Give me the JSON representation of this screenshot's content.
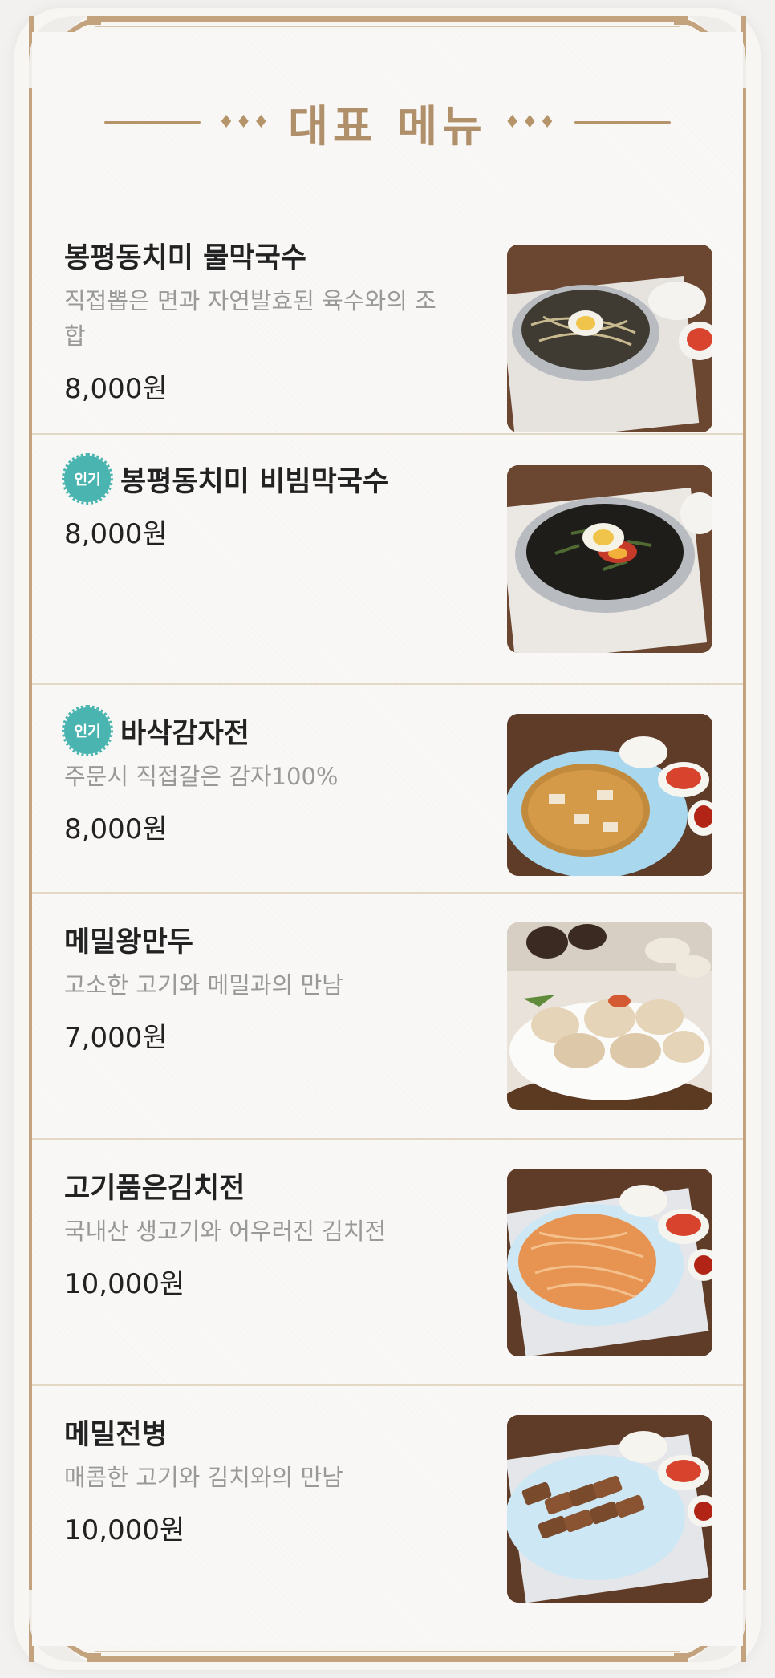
{
  "section_title": "대표 메뉴",
  "header_ornament": "♦♦♦",
  "colors": {
    "frame_gold": "#c3a27e",
    "title_gold": "#b0906a",
    "badge_teal": "#4ab5b0",
    "divider": "#e3d7c6"
  },
  "menu": [
    {
      "name": "봉평동치미 물막국수",
      "description": "직접뽑은 면과 자연발효된 육수와의 조합",
      "price": "8,000원",
      "badge": "",
      "photo_icon": "cold-buckwheat-noodle-photo"
    },
    {
      "name": "봉평동치미 비빔막국수",
      "description": "",
      "price": "8,000원",
      "badge": "인기",
      "photo_icon": "spicy-buckwheat-noodle-photo"
    },
    {
      "name": "바삭감자전",
      "description": "주문시 직접갈은 감자100%",
      "price": "8,000원",
      "badge": "인기",
      "photo_icon": "potato-pancake-photo"
    },
    {
      "name": "메밀왕만두",
      "description": "고소한 고기와 메밀과의 만남",
      "price": "7,000원",
      "badge": "",
      "photo_icon": "dumpling-photo"
    },
    {
      "name": "고기품은김치전",
      "description": "국내산 생고기와 어우러진 김치전",
      "price": "10,000원",
      "badge": "",
      "photo_icon": "kimchi-pancake-photo"
    },
    {
      "name": "메밀전병",
      "description": "매콤한 고기와 김치와의 만남",
      "price": "10,000원",
      "badge": "",
      "photo_icon": "buckwheat-crepe-photo"
    }
  ]
}
